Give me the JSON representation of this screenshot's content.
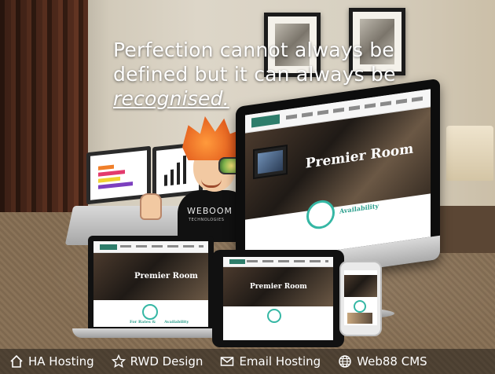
{
  "headline": {
    "line1": "Perfection cannot always be",
    "line2": "defined but it can always be",
    "emphasis": "recognised."
  },
  "mascot_shirt": {
    "brand": "WEBOOM",
    "subtitle": "TECHNOLOGIES"
  },
  "screens": {
    "hero_title": "Premier Room",
    "availability": "Availability",
    "laptop_hero_title": "Premier Room",
    "tablet_hero_title": "Premier Room",
    "laptop_availability": "Availability",
    "laptop_for_rates": "For Rates &"
  },
  "features": [
    {
      "icon": "home-icon",
      "label": "HA Hosting"
    },
    {
      "icon": "star-icon",
      "label": "RWD Design"
    },
    {
      "icon": "mail-icon",
      "label": "Email Hosting"
    },
    {
      "icon": "globe-icon",
      "label": "Web88 CMS"
    }
  ],
  "colors": {
    "accent_teal": "#35b7a4",
    "footer_bg": "#0a0a0a",
    "text": "#ffffff"
  }
}
